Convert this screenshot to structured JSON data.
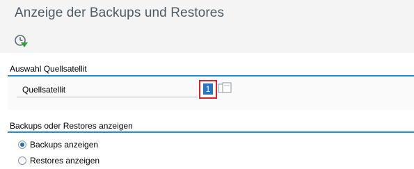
{
  "window": {
    "title": "Anzeige der Backups und Restores",
    "execute_icon": "execute-clock-icon"
  },
  "section_source": {
    "header": "Auswahl Quellsatellit",
    "field_label": "Quellsatellit",
    "field_value": "1",
    "value_help_icon": "value-help-icon"
  },
  "section_display": {
    "header": "Backups oder Restores anzeigen",
    "options": [
      {
        "label": "Backups anzeigen",
        "selected": true
      },
      {
        "label": "Restores anzeigen",
        "selected": false
      }
    ]
  },
  "colors": {
    "accent": "#1f8dd6",
    "title_text": "#4c5a66",
    "focus_border": "#e0202b",
    "selection": "#2a74c4"
  }
}
